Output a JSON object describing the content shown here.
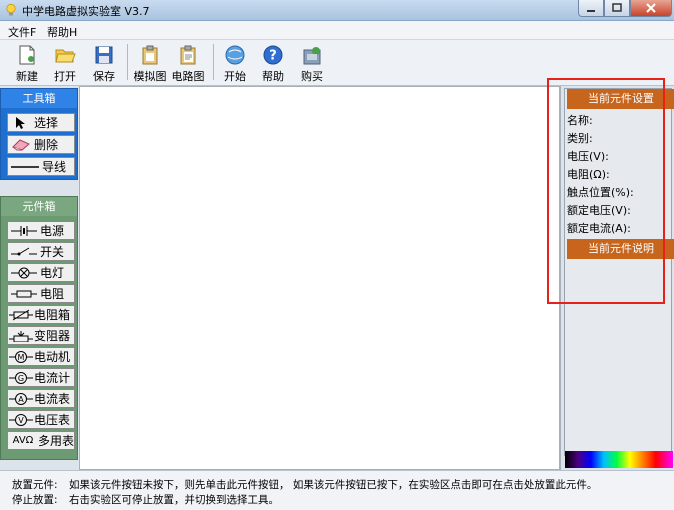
{
  "window": {
    "title": "中学电路虚拟实验室 V3.7"
  },
  "menu": [
    {
      "label": "文件F"
    },
    {
      "label": "帮助H"
    }
  ],
  "toolbar": {
    "buttons": [
      {
        "label": "新建",
        "icon": "new-doc-icon"
      },
      {
        "label": "打开",
        "icon": "folder-open-icon"
      },
      {
        "label": "保存",
        "icon": "save-disk-icon"
      },
      {
        "label": "模拟图",
        "icon": "clipboard-icon"
      },
      {
        "label": "电路图",
        "icon": "clipboard-doc-icon"
      },
      {
        "label": "开始",
        "icon": "start-globe-icon"
      },
      {
        "label": "帮助",
        "icon": "help-icon"
      },
      {
        "label": "购买",
        "icon": "buy-icon"
      }
    ]
  },
  "toolbox": {
    "title": "工具箱",
    "tools": [
      {
        "label": "选择",
        "icon": "pointer-arrow-icon"
      },
      {
        "label": "删除",
        "icon": "eraser-icon"
      },
      {
        "label": "导线",
        "icon": "wire-line-icon"
      }
    ]
  },
  "components": {
    "title": "元件箱",
    "items": [
      {
        "label": "电源",
        "icon": "battery-symbol-icon"
      },
      {
        "label": "开关",
        "icon": "switch-symbol-icon"
      },
      {
        "label": "电灯",
        "icon": "lamp-symbol-icon"
      },
      {
        "label": "电阻",
        "icon": "resistor-symbol-icon"
      },
      {
        "label": "电阻箱",
        "icon": "resistor-box-symbol-icon"
      },
      {
        "label": "变阻器",
        "icon": "rheostat-symbol-icon"
      },
      {
        "label": "电动机",
        "icon": "motor-symbol-icon"
      },
      {
        "label": "电流计",
        "icon": "galvanometer-symbol-icon"
      },
      {
        "label": "电流表",
        "icon": "ammeter-symbol-icon"
      },
      {
        "label": "电压表",
        "icon": "voltmeter-symbol-icon"
      },
      {
        "label": "多用表",
        "prefix": "AVΩ",
        "icon": "multimeter-symbol-icon"
      }
    ]
  },
  "properties": {
    "settings_title": "当前元件设置",
    "fields": [
      {
        "label": "名称:"
      },
      {
        "label": "类别:"
      },
      {
        "label": "电压(V):"
      },
      {
        "label": "电阻(Ω):"
      },
      {
        "label": "触点位置(%):"
      },
      {
        "label": "额定电压(V):"
      },
      {
        "label": "额定电流(A):"
      }
    ],
    "description_title": "当前元件说明"
  },
  "status": [
    {
      "key": "放置元件:",
      "text": "如果该元件按钮未按下，则先单击此元件按钮， 如果该元件按钮已按下，在实验区点击即可在点击处放置此元件。"
    },
    {
      "key": "停止放置:",
      "text": "右击实验区可停止放置，并切换到选择工具。"
    }
  ],
  "colors": {
    "toolbox_blue": "#1f6fd1",
    "component_green": "#6c9a72",
    "settings_orange": "#c8651c",
    "highlight_red": "#e8201c"
  }
}
